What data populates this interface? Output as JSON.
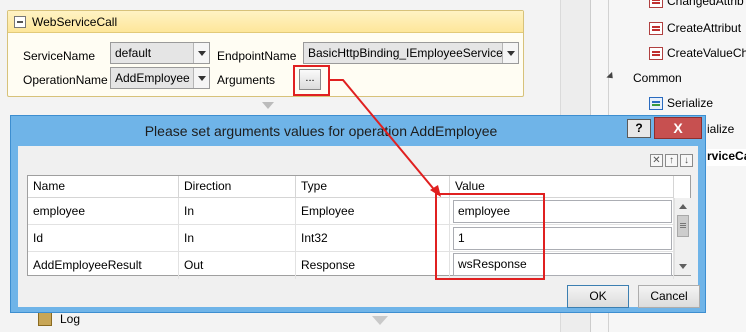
{
  "workflow": {
    "title": "WebServiceCall",
    "service_name_label": "ServiceName",
    "service_name_value": "default",
    "endpoint_name_label": "EndpointName",
    "endpoint_name_value": "BasicHttpBinding_IEmployeeService",
    "operation_name_label": "OperationName",
    "operation_name_value": "AddEmployee",
    "arguments_label": "Arguments",
    "arguments_button": "..."
  },
  "background": {
    "log_label": "Log"
  },
  "toolbox": {
    "items": [
      {
        "label": "ChangedAttrib",
        "icon": "attribute-icon"
      },
      {
        "label": "CreateAttribut",
        "icon": "attribute-icon"
      },
      {
        "label": "CreateValueCh",
        "icon": "attribute-icon"
      }
    ],
    "category": "Common",
    "common_items": [
      {
        "label": "Serialize",
        "icon": "serialize-icon"
      },
      {
        "label": "ialize",
        "icon": ""
      }
    ],
    "selected_item": "rviceCa"
  },
  "dialog": {
    "title": "Please set arguments values for operation AddEmployee",
    "help_button": "?",
    "close_button": "X",
    "grid_tools": [
      "✕",
      "↑",
      "↓"
    ],
    "columns": [
      "Name",
      "Direction",
      "Type",
      "Value"
    ],
    "rows": [
      {
        "name": "employee",
        "direction": "In",
        "type": "Employee",
        "value": "employee"
      },
      {
        "name": "Id",
        "direction": "In",
        "type": "Int32",
        "value": "1"
      },
      {
        "name": "AddEmployeeResult",
        "direction": "Out",
        "type": "Response",
        "value": "wsResponse"
      }
    ],
    "ok_button": "OK",
    "cancel_button": "Cancel"
  },
  "colors": {
    "annotation_red": "#e02020",
    "dialog_frame": "#6fb4e8",
    "close_button": "#c75050"
  }
}
